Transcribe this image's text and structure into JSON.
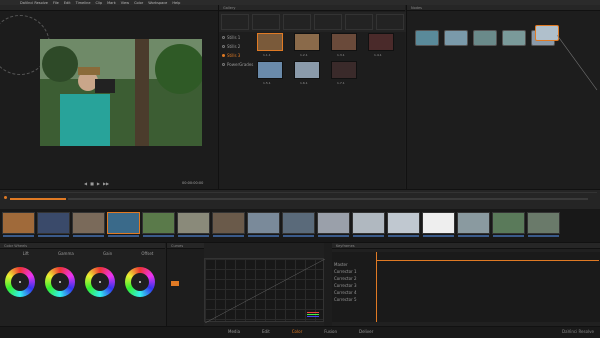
{
  "app": {
    "title": "DaVinci Resolve"
  },
  "menu": [
    "DaVinci Resolve",
    "File",
    "Edit",
    "Timeline",
    "Clip",
    "Mark",
    "View",
    "Color",
    "Workspace",
    "Help"
  ],
  "viewer": {
    "title": "",
    "timecode": "00:00:00:00"
  },
  "gallery": {
    "title": "Gallery",
    "albums": [
      "Stills 1",
      "Stills 2",
      "Stills 3",
      "PowerGrades"
    ],
    "stills": [
      "1.1.1",
      "1.2.1",
      "1.3.1",
      "1.4.1",
      "1.5.1",
      "1.6.1",
      "1.7.1"
    ]
  },
  "nodes": {
    "title": "Nodes",
    "count": 6
  },
  "clips": {
    "count": 16,
    "selected_index": 3
  },
  "wheels": {
    "title": "Color Wheels",
    "labels": [
      "Lift",
      "Gamma",
      "Gain",
      "Offset"
    ]
  },
  "curves": {
    "title": "Curves"
  },
  "keyframes": {
    "title": "Keyframes",
    "tracks": [
      "Master",
      "Corrector 1",
      "Corrector 2",
      "Corrector 3",
      "Corrector 4",
      "Corrector 5"
    ]
  },
  "pages": [
    "Media",
    "Edit",
    "Color",
    "Fusion",
    "Deliver"
  ],
  "brand": "DaVinci Resolve",
  "colors": {
    "accent": "#e07a24",
    "panel": "#1f1f1f"
  }
}
